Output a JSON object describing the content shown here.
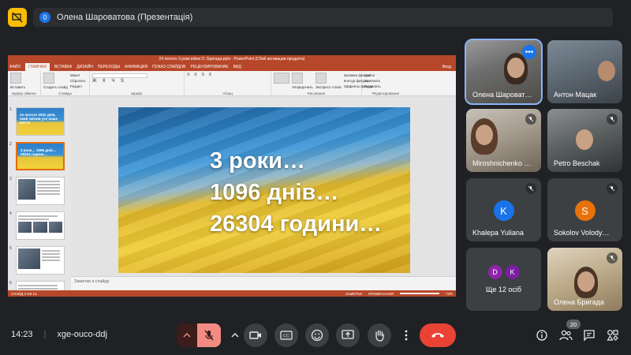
{
  "top_bar": {
    "participant_count": "0",
    "title": "Олена Шароватова (Презентація)"
  },
  "powerpoint": {
    "window_title": "24 лютого 3 роки війни О. Бригада.pptx - PowerPoint (Сбой активации продукта)",
    "tabs": [
      "ФАЙЛ",
      "ГЛАВНАЯ",
      "ВСТАВКА",
      "ДИЗАЙН",
      "ПЕРЕХОДЫ",
      "АНИМАЦИЯ",
      "ПОКАЗ СЛАЙДОВ",
      "РЕЦЕНЗИРОВАНИЕ",
      "ВИД"
    ],
    "sign_in": "Вход",
    "ribbon": {
      "paste": "Вставить",
      "clipboard": "Буфер обмена",
      "layout": "Макет",
      "reset": "Сбросить",
      "section": "Раздел",
      "create_slide": "Создать слайд",
      "slides": "Слайды",
      "font": "Шрифт",
      "paragraph": "Абзац",
      "arrange": "Упорядочить",
      "quick_styles": "Экспресс-стили",
      "shape_fill": "Заливка фигуры",
      "shape_outline": "Контур фигуры",
      "shape_effects": "Эффекты фигуры",
      "drawing": "Рисование",
      "find": "Найти",
      "replace": "Заменить",
      "select": "Выделить",
      "editing": "Редактирование"
    },
    "thumbnails": [
      {
        "num": "1",
        "text": "24 лютого 2022 днів, який змінив усе наше життя"
      },
      {
        "num": "2",
        "text": "3 роки… 1096 днів… 26304 години…"
      },
      {
        "num": "3",
        "text": ""
      },
      {
        "num": "4",
        "text": ""
      },
      {
        "num": "5",
        "text": ""
      },
      {
        "num": "6",
        "text": ""
      }
    ],
    "slide": {
      "line1": "3 роки…",
      "line2": "1096 днів…",
      "line3": "26304 години…"
    },
    "notes_placeholder": "Заметки к слайду",
    "status": {
      "slide_info": "СЛАЙД 2 ИЗ 13",
      "notes": "ЗАМЕТКИ",
      "comments": "ПРИМЕЧАНИЯ",
      "zoom": "73%"
    }
  },
  "participants": [
    {
      "name": "Олена Шароватова",
      "display": "Олена Шароват…"
    },
    {
      "name": "Антон Мацак",
      "display": "Антон Мацак"
    },
    {
      "name": "Miroshnichenko",
      "display": "Miroshnichenko …"
    },
    {
      "name": "Petro Beschak",
      "display": "Petro Beschak"
    },
    {
      "name": "Khalepa Yuliana",
      "display": "Khalepa Yuliana",
      "initial": "K",
      "color": "#1a73e8"
    },
    {
      "name": "Sokolov Volodymyr",
      "display": "Sokolov Volody…",
      "initial": "S",
      "color": "#e8710a"
    },
    {
      "name": "Олена Бригада",
      "display": "Олена Бригада"
    }
  ],
  "others": {
    "label": "Ще 12 осіб",
    "initials": [
      "D",
      "K"
    ],
    "colors": [
      "#8e24aa",
      "#7b1fa2"
    ]
  },
  "bottom_bar": {
    "time": "14:23",
    "meeting_code": "xge-ouco-ddj",
    "people_count": "20"
  },
  "colors": {
    "accent_blue": "#1a73e8",
    "leave_red": "#ea4335",
    "muted_mic": "#f28b82",
    "powerpoint_orange": "#b7472a"
  }
}
